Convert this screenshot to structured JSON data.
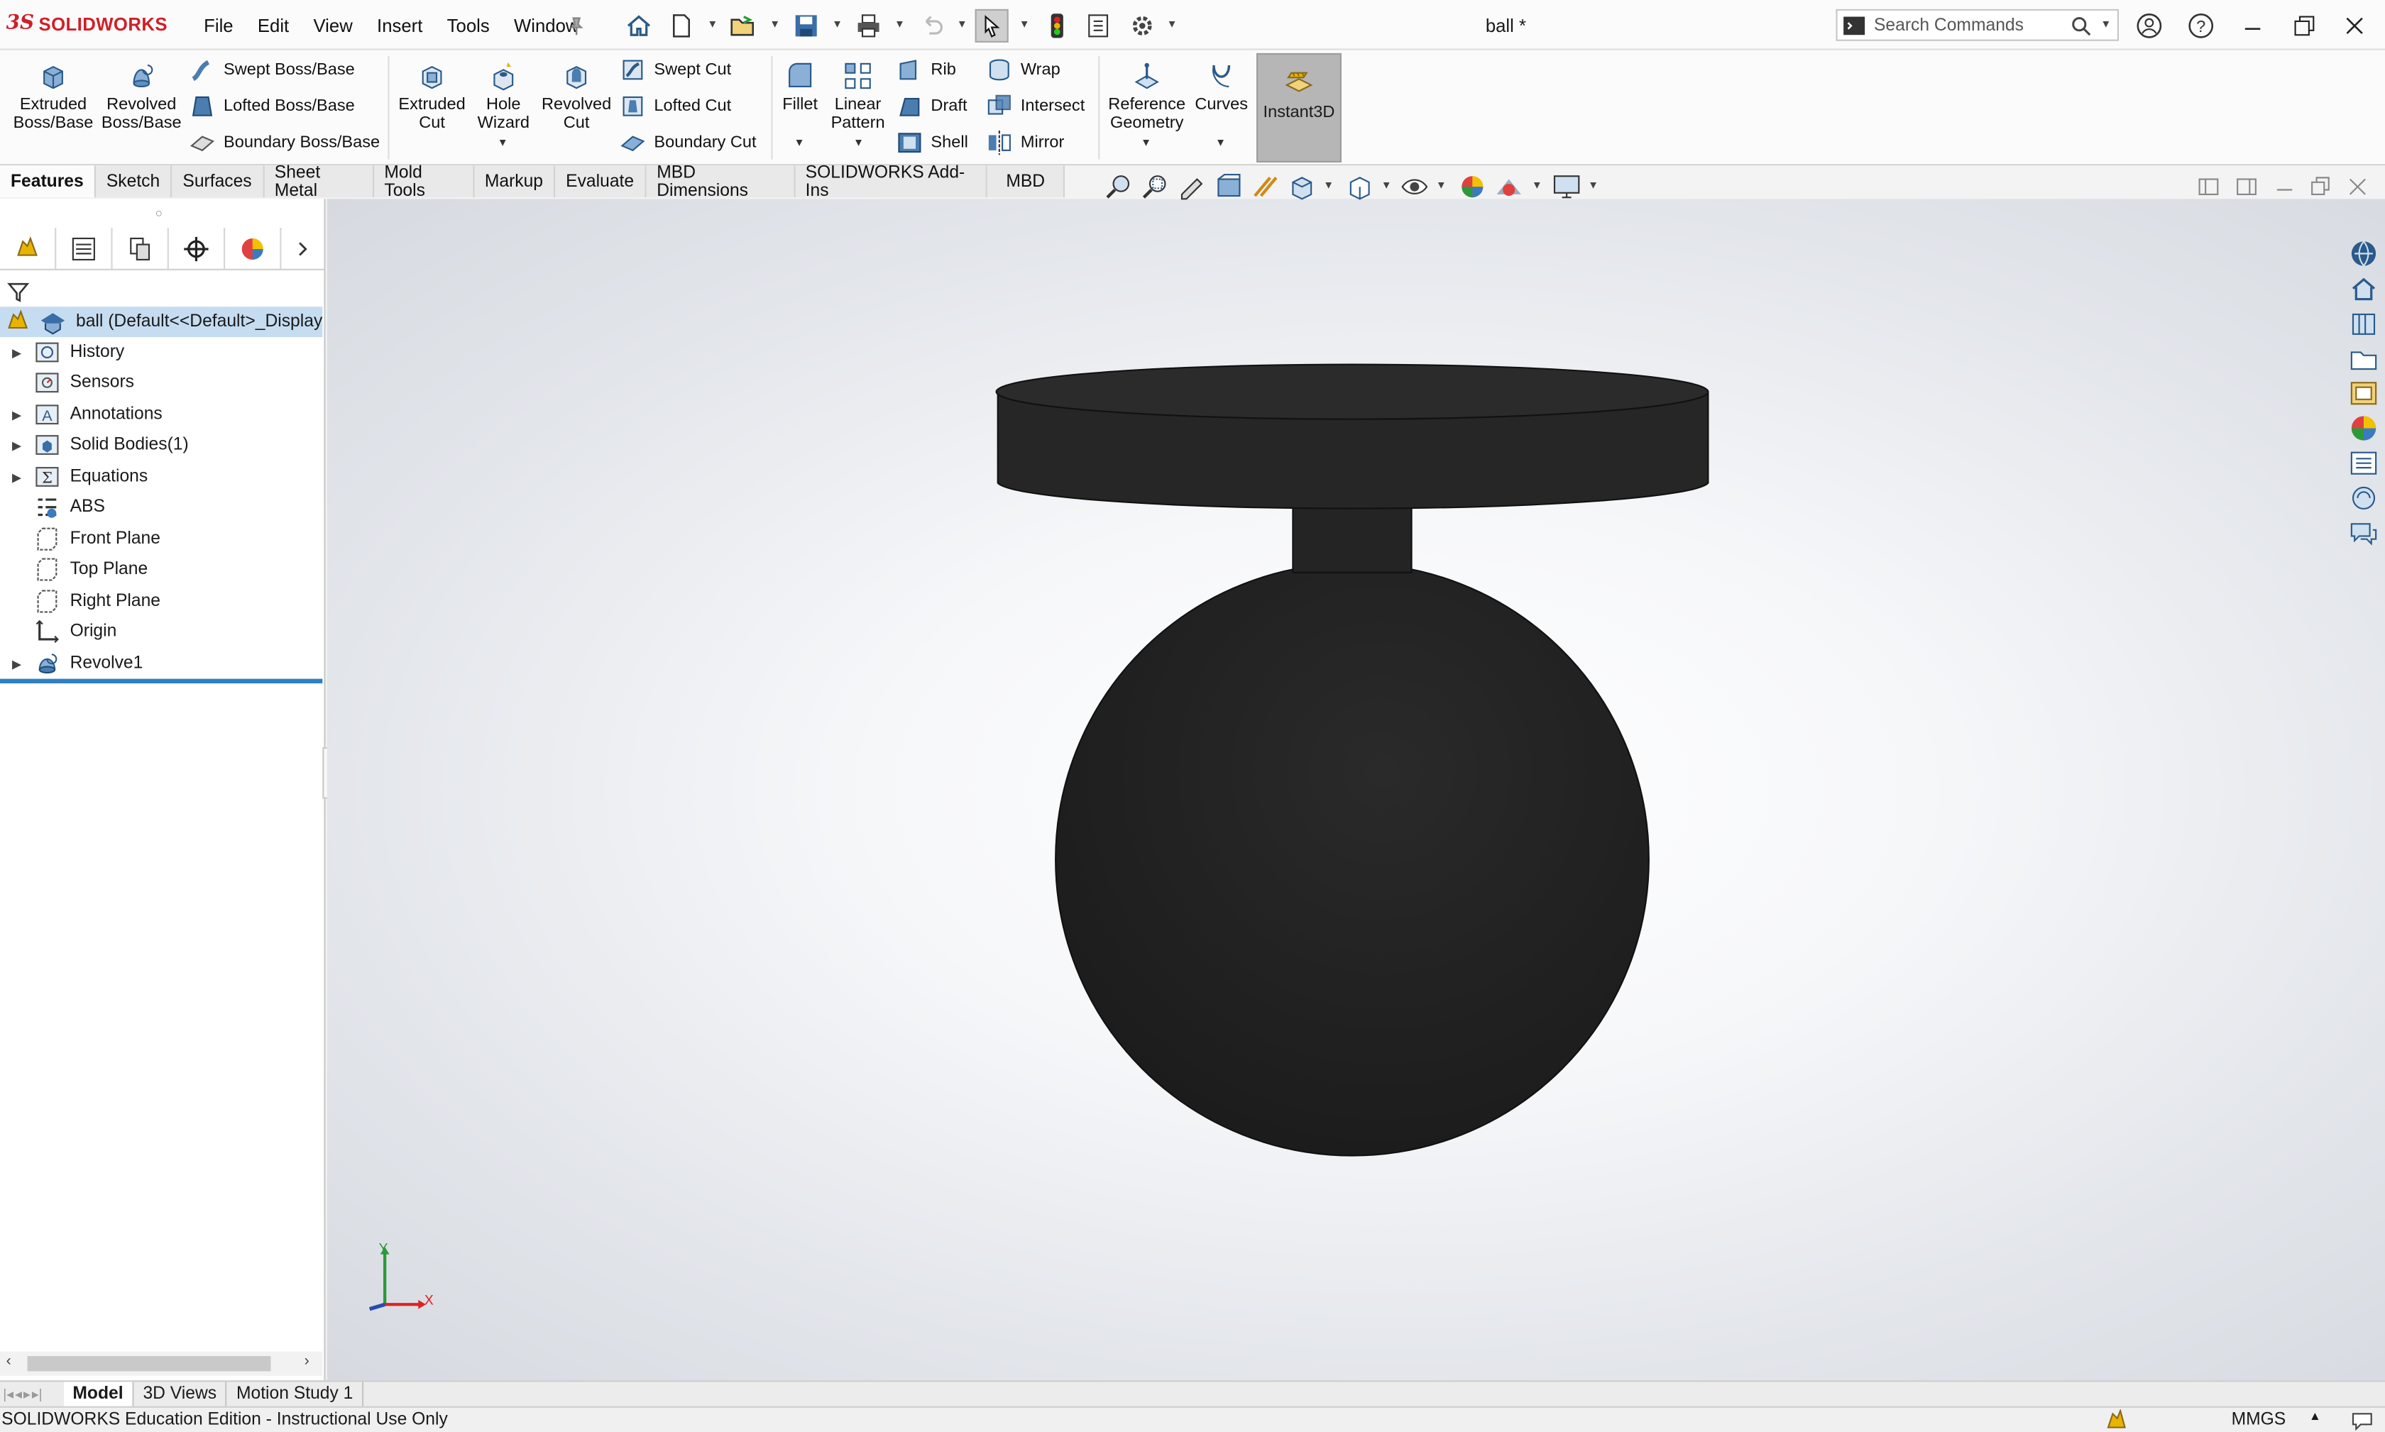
{
  "app": {
    "logo_ds": "3S",
    "logo_name": "SOLIDWORKS",
    "menu": [
      "File",
      "Edit",
      "View",
      "Insert",
      "Tools",
      "Window"
    ],
    "doc_title": "ball *",
    "search_placeholder": "Search Commands"
  },
  "ribbon": {
    "extruded_boss": "Extruded\nBoss/Base",
    "revolved_boss": "Revolved\nBoss/Base",
    "swept_boss": "Swept Boss/Base",
    "lofted_boss": "Lofted Boss/Base",
    "boundary_boss": "Boundary Boss/Base",
    "extruded_cut": "Extruded\nCut",
    "hole_wizard": "Hole\nWizard",
    "revolved_cut": "Revolved\nCut",
    "swept_cut": "Swept Cut",
    "lofted_cut": "Lofted Cut",
    "boundary_cut": "Boundary Cut",
    "fillet": "Fillet",
    "linear_pattern": "Linear\nPattern",
    "rib": "Rib",
    "draft": "Draft",
    "shell": "Shell",
    "wrap": "Wrap",
    "intersect": "Intersect",
    "mirror": "Mirror",
    "reference_geometry": "Reference\nGeometry",
    "curves": "Curves",
    "instant3d": "Instant3D"
  },
  "command_tabs": [
    "Features",
    "Sketch",
    "Surfaces",
    "Sheet Metal",
    "Mold Tools",
    "Markup",
    "Evaluate",
    "MBD Dimensions",
    "SOLIDWORKS Add-Ins",
    "MBD"
  ],
  "tree": {
    "root": "ball  (Default<<Default>_Display",
    "items": [
      "History",
      "Sensors",
      "Annotations",
      "Solid Bodies(1)",
      "Equations",
      "ABS",
      "Front Plane",
      "Top Plane",
      "Right Plane",
      "Origin",
      "Revolve1"
    ]
  },
  "triad": {
    "y": "Y",
    "x": "X"
  },
  "bottom_tabs": [
    "Model",
    "3D Views",
    "Motion Study 1"
  ],
  "status": {
    "text": "SOLIDWORKS Education Edition - Instructional Use Only",
    "units": "MMGS"
  },
  "colors": {
    "brand_red": "#d11e27",
    "model_body": "#232323",
    "selection_blue": "#c6dcf0",
    "rollback_bar": "#2f7fc1"
  }
}
